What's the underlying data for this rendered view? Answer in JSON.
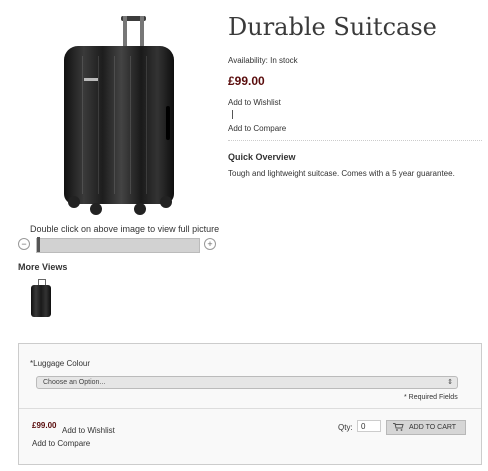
{
  "product": {
    "title": "Durable Suitcase",
    "availability": "Availability: In stock",
    "price": "£99.00",
    "wishlist_label": "Add to Wishlist",
    "separator": "|",
    "compare_label": "Add to Compare"
  },
  "quick_overview": {
    "title": "Quick Overview",
    "text": "Tough and lightweight suitcase. Comes with a 5 year guarantee."
  },
  "image_viewer": {
    "caption": "Double click on above image to view full picture",
    "zoom_out_icon": "minus-circle-icon",
    "zoom_in_icon": "plus-circle-icon",
    "zoom_minus": "−",
    "zoom_plus": "+",
    "zoom_level": 0
  },
  "more_views": {
    "title": "More Views"
  },
  "options": {
    "label": "*Luggage Colour",
    "select_value": "Choose an Option...",
    "select_arrow": "⇕",
    "required_note": "* Required Fields"
  },
  "add_to_cart": {
    "price": "£99.00",
    "wishlist_label": "Add to Wishlist",
    "compare_label": "Add to Compare",
    "qty_label": "Qty:",
    "qty_value": "0",
    "button_label": "ADD TO CART",
    "cart_icon": "cart-icon"
  },
  "colors": {
    "price": "#5a0d0d",
    "button_bg": "#d6d6d6"
  }
}
